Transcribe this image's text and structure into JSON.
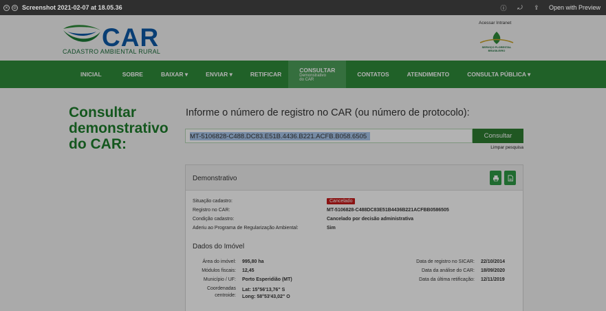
{
  "window": {
    "title": "Screenshot 2021-02-07 at 18.05.36",
    "open_with": "Open with Preview",
    "icons": [
      "close-icon",
      "minimize-icon",
      "info-icon",
      "rotate-icon",
      "share-icon"
    ]
  },
  "header": {
    "logo_text": "CAR",
    "logo_subtitle": "CADASTRO AMBIENTAL RURAL",
    "intranet": "Acessar Intranet",
    "partner": "SERVIÇO FLORESTAL BRASILEIRO"
  },
  "nav": {
    "items": [
      {
        "label": "INICIAL"
      },
      {
        "label": "SOBRE"
      },
      {
        "label": "BAIXAR ▾"
      },
      {
        "label": "ENVIAR ▾"
      },
      {
        "label": "RETIFICAR"
      },
      {
        "label": "CONSULTAR",
        "sub": "Demonstrativo do CAR"
      },
      {
        "label": "CONTATOS"
      },
      {
        "label": "ATENDIMENTO"
      },
      {
        "label": "CONSULTA PÚBLICA ▾"
      }
    ],
    "active_color": "#4da05a",
    "bar_color": "#2f8c3a"
  },
  "main": {
    "title": "Consultar demonstrativo do CAR:",
    "prompt": "Informe o número de registro no CAR (ou número de protocolo):",
    "search_value": "MT-5106828-C488.DC83.E51B.4436.B221.ACFB.B058.6505",
    "search_button": "Consultar",
    "clear_link": "Limpar pesquisa"
  },
  "panel": {
    "title": "Demonstrativo",
    "status_label": "Situação cadastro:",
    "status_value": "Cancelado",
    "registro_label": "Registro no CAR:",
    "registro_value": "MT-5106828-C488DC83E51B4436B221ACFBB0586505",
    "condicao_label": "Condição cadastro:",
    "condicao_value": "Cancelado por decisão administrativa",
    "adesao_label": "Aderiu ao Programa de Regularização Ambiental:",
    "adesao_value": "Sim",
    "section_title": "Dados do Imóvel",
    "area_label": "Área do imóvel:",
    "area_value": "995,80 ha",
    "modulos_label": "Módulos fiscais:",
    "modulos_value": "12,45",
    "municipio_label": "Município / UF:",
    "municipio_value": "Porto Esperidião (MT)",
    "coord_label_1": "Coordenadas",
    "coord_label_2": "centroide:",
    "lat_value": "Lat: 15°56'13,76\" S",
    "long_value": "Long: 58°53'43,02\" O",
    "data_registro_label": "Data de registro no SICAR:",
    "data_registro_value": "22/10/2014",
    "data_analise_label": "Data da análise do CAR:",
    "data_analise_value": "18/09/2020",
    "data_retificacao_label": "Data da última retificação:",
    "data_retificacao_value": "12/11/2019"
  }
}
